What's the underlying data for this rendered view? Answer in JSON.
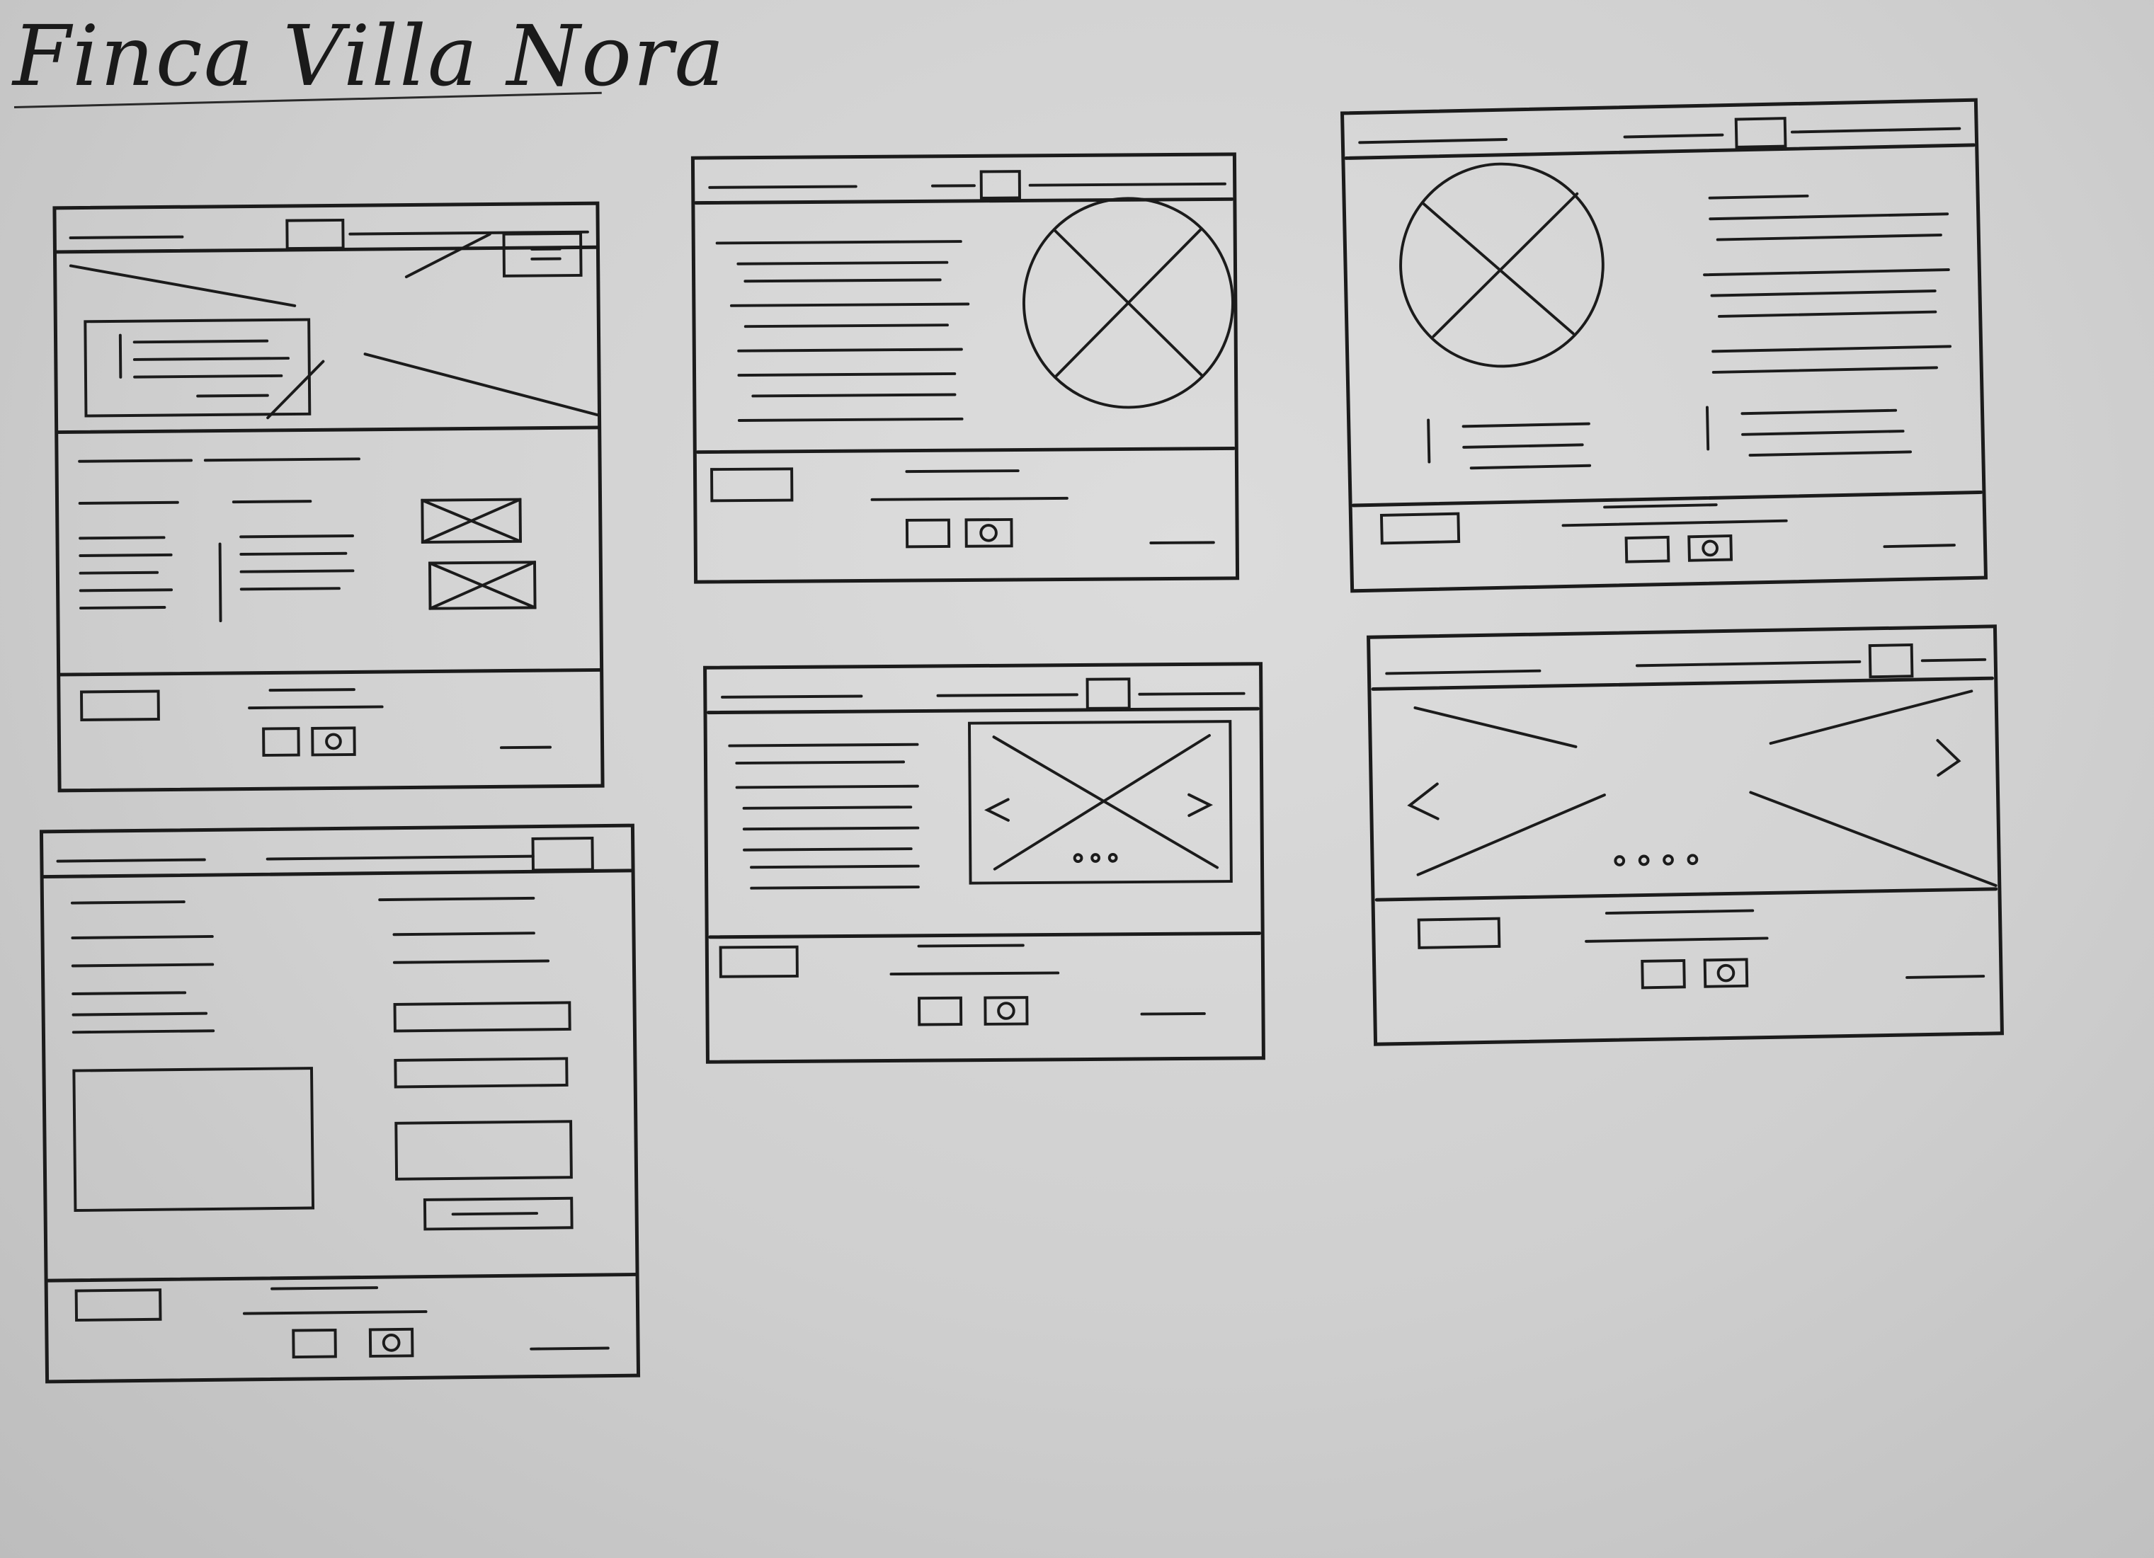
{
  "sketch": {
    "title": "Finca Villa Nora"
  },
  "colors": {
    "ink": "#1b1b1b",
    "paper": "#d6d6d6"
  },
  "wireframes": [
    {
      "name": "wireframe-home",
      "icons": [
        "menu-icon",
        "image-placeholder-icon",
        "facebook-icon",
        "instagram-icon"
      ]
    },
    {
      "name": "wireframe-villa",
      "icons": [
        "image-placeholder-icon",
        "facebook-icon",
        "instagram-icon"
      ]
    },
    {
      "name": "wireframe-services",
      "icons": [
        "image-placeholder-icon",
        "facebook-icon",
        "instagram-icon"
      ]
    },
    {
      "name": "wireframe-contact",
      "icons": [
        "facebook-icon",
        "instagram-icon"
      ]
    },
    {
      "name": "wireframe-rooms",
      "icons": [
        "image-placeholder-icon",
        "chevron-left-icon",
        "chevron-right-icon",
        "facebook-icon",
        "instagram-icon"
      ]
    },
    {
      "name": "wireframe-gallery",
      "icons": [
        "image-placeholder-icon",
        "chevron-left-icon",
        "chevron-right-icon",
        "facebook-icon",
        "instagram-icon"
      ]
    }
  ]
}
